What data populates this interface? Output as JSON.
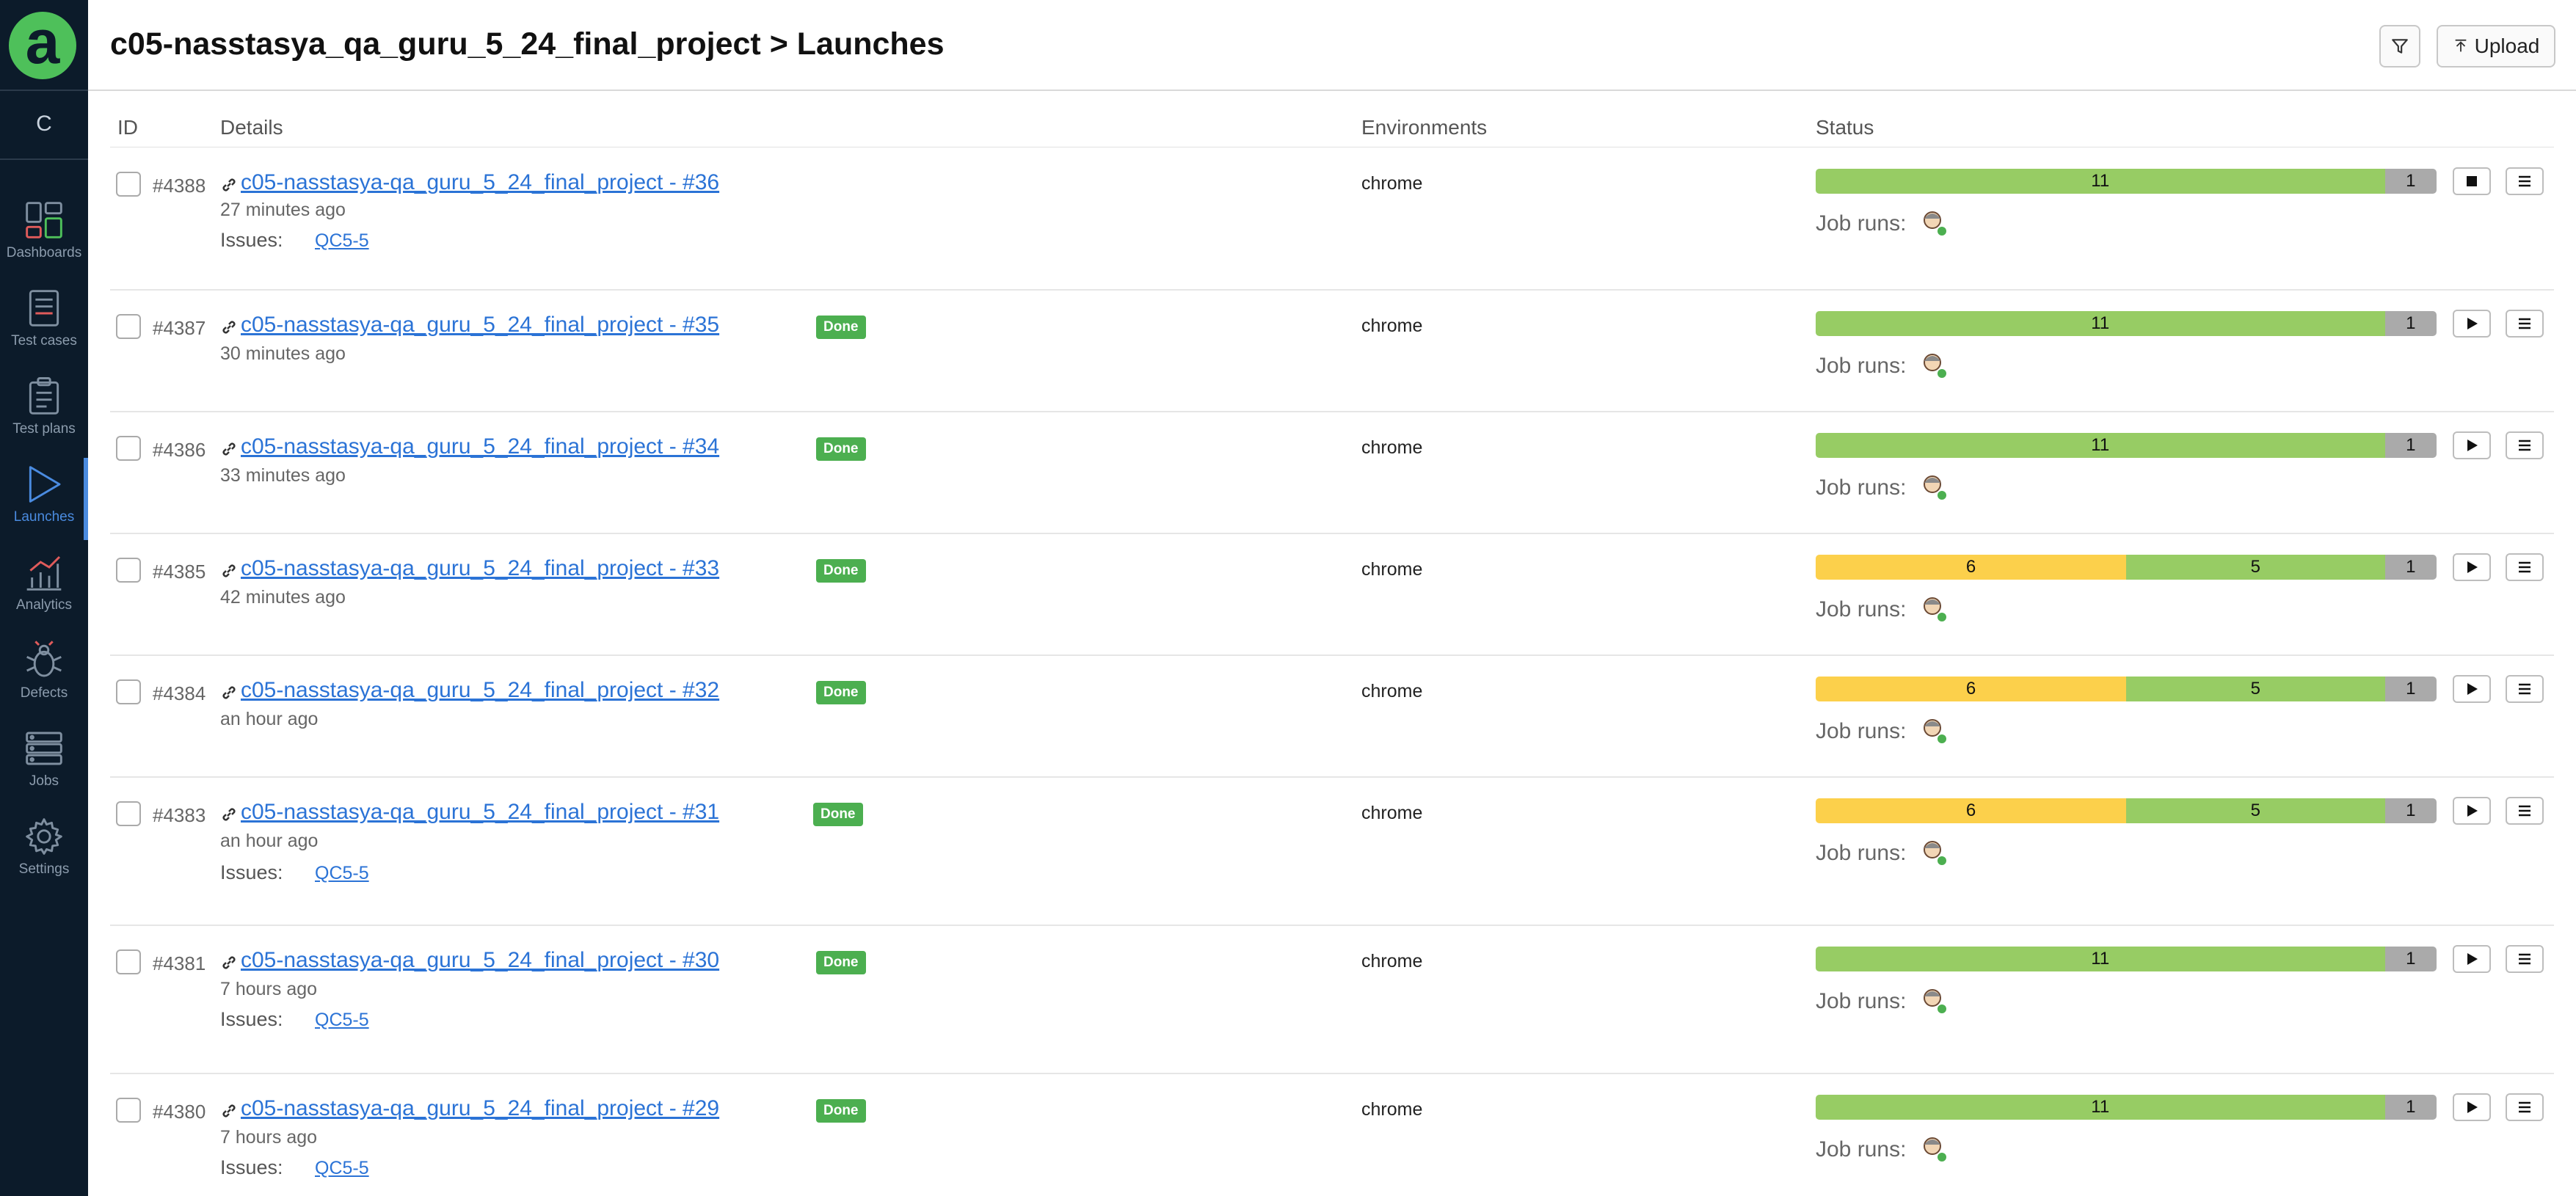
{
  "sidebar": {
    "logo_letter": "a",
    "project_letter": "C",
    "items": [
      {
        "label": "Dashboards",
        "icon": "dashboards-icon"
      },
      {
        "label": "Test cases",
        "icon": "test-cases-icon"
      },
      {
        "label": "Test plans",
        "icon": "test-plans-icon"
      },
      {
        "label": "Launches",
        "icon": "launches-icon",
        "active": true
      },
      {
        "label": "Analytics",
        "icon": "analytics-icon"
      },
      {
        "label": "Defects",
        "icon": "bug-icon"
      },
      {
        "label": "Jobs",
        "icon": "jobs-icon"
      },
      {
        "label": "Settings",
        "icon": "gear-icon"
      }
    ]
  },
  "header": {
    "project": "c05-nasstasya_qa_guru_5_24_final_project",
    "separator": ">",
    "page": "Launches",
    "upload_label": "Upload"
  },
  "table": {
    "columns": {
      "id": "ID",
      "details": "Details",
      "environments": "Environments",
      "status": "Status"
    },
    "job_runs_label": "Job runs:",
    "issues_label": "Issues:",
    "rows": [
      {
        "id": "#4388",
        "name": "c05-nasstasya-qa_guru_5_24_final_project - #36",
        "badge": "",
        "time": "27 minutes ago",
        "issue": "QC5-5",
        "env": "chrome",
        "status": [
          {
            "type": "passed",
            "value": 11
          },
          {
            "type": "unknown",
            "value": 1
          }
        ],
        "action": "stop"
      },
      {
        "id": "#4387",
        "name": "c05-nasstasya-qa_guru_5_24_final_project - #35",
        "badge": "Done",
        "time": "30 minutes ago",
        "issue": "",
        "env": "chrome",
        "status": [
          {
            "type": "passed",
            "value": 11
          },
          {
            "type": "unknown",
            "value": 1
          }
        ],
        "action": "play"
      },
      {
        "id": "#4386",
        "name": "c05-nasstasya-qa_guru_5_24_final_project - #34",
        "badge": "Done",
        "time": "33 minutes ago",
        "issue": "",
        "env": "chrome",
        "status": [
          {
            "type": "passed",
            "value": 11
          },
          {
            "type": "unknown",
            "value": 1
          }
        ],
        "action": "play"
      },
      {
        "id": "#4385",
        "name": "c05-nasstasya-qa_guru_5_24_final_project - #33",
        "badge": "Done",
        "time": "42 minutes ago",
        "issue": "",
        "env": "chrome",
        "status": [
          {
            "type": "broken",
            "value": 6
          },
          {
            "type": "passed",
            "value": 5
          },
          {
            "type": "unknown",
            "value": 1
          }
        ],
        "action": "play"
      },
      {
        "id": "#4384",
        "name": "c05-nasstasya-qa_guru_5_24_final_project - #32",
        "badge": "Done",
        "time": "an hour ago",
        "issue": "",
        "env": "chrome",
        "status": [
          {
            "type": "broken",
            "value": 6
          },
          {
            "type": "passed",
            "value": 5
          },
          {
            "type": "unknown",
            "value": 1
          }
        ],
        "action": "play"
      },
      {
        "id": "#4383",
        "name": "c05-nasstasya-qa_guru_5_24_final_project - #31",
        "badge": "Done",
        "time": "an hour ago",
        "issue": "QC5-5",
        "env": "chrome",
        "status": [
          {
            "type": "broken",
            "value": 6
          },
          {
            "type": "passed",
            "value": 5
          },
          {
            "type": "unknown",
            "value": 1
          }
        ],
        "action": "play"
      },
      {
        "id": "#4381",
        "name": "c05-nasstasya-qa_guru_5_24_final_project - #30",
        "badge": "Done",
        "time": "7 hours ago",
        "issue": "QC5-5",
        "env": "chrome",
        "status": [
          {
            "type": "passed",
            "value": 11
          },
          {
            "type": "unknown",
            "value": 1
          }
        ],
        "action": "play"
      },
      {
        "id": "#4380",
        "name": "c05-nasstasya-qa_guru_5_24_final_project - #29",
        "badge": "Done",
        "time": "7 hours ago",
        "issue": "QC5-5",
        "env": "chrome",
        "status": [
          {
            "type": "passed",
            "value": 11
          },
          {
            "type": "unknown",
            "value": 1
          }
        ],
        "action": "play"
      }
    ]
  }
}
